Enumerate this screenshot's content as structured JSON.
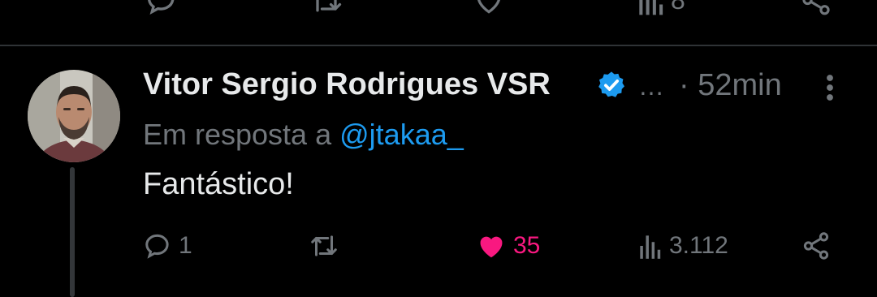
{
  "previous_tweet": {
    "views": "8"
  },
  "tweet": {
    "author_name": "Vitor Sergio Rodrigues VSR",
    "verified": true,
    "truncation": "…",
    "time_separator": "·",
    "time": "52min",
    "reply_prefix": "Em resposta a",
    "reply_to": "@jtakaa_",
    "text": "Fantástico!",
    "actions": {
      "replies": "1",
      "retweets": "",
      "likes": "35",
      "liked": true,
      "views": "3.112"
    }
  },
  "colors": {
    "background": "#000000",
    "text": "#e7e9ea",
    "muted": "#71767b",
    "link": "#1d9bf0",
    "like": "#f91880",
    "verified": "#1d9bf0"
  },
  "icons": {
    "reply": "reply-icon",
    "retweet": "retweet-icon",
    "like": "heart-icon",
    "views": "views-icon",
    "share": "share-icon",
    "more": "more-vertical-icon",
    "verified": "verified-badge-icon"
  }
}
